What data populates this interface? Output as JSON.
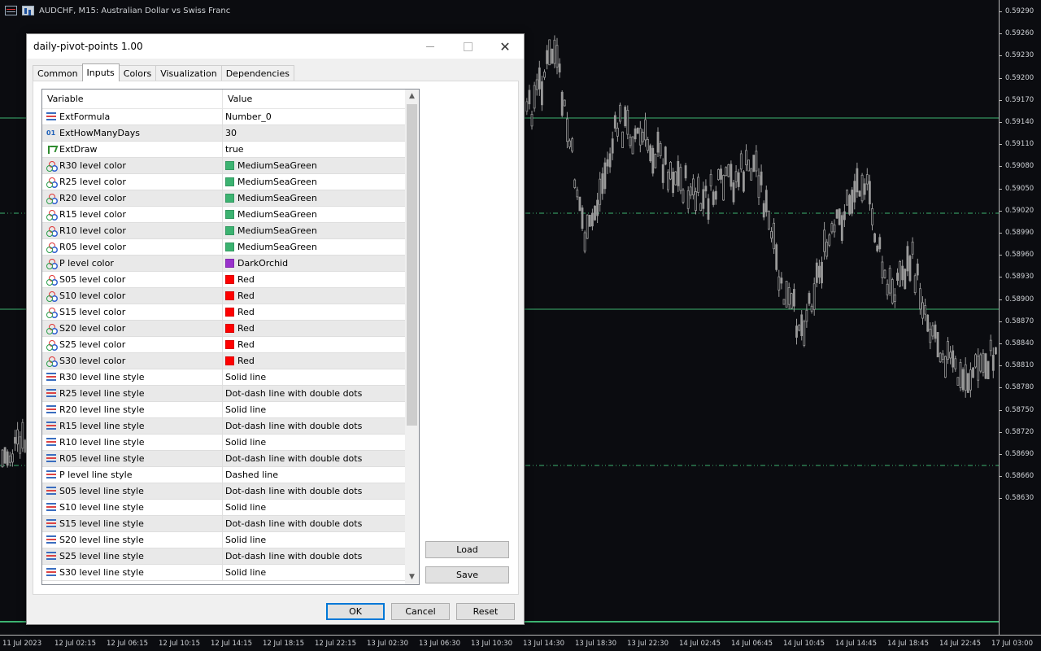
{
  "chart": {
    "symbol_title": "AUDCHF, M15:  Australian Dollar vs Swiss  Franc",
    "price_ticks": [
      "0.59290",
      "0.59260",
      "0.59230",
      "0.59200",
      "0.59170",
      "0.59140",
      "0.59110",
      "0.59080",
      "0.59050",
      "0.59020",
      "0.58990",
      "0.58960",
      "0.58930",
      "0.58900",
      "0.58870",
      "0.58840",
      "0.58810",
      "0.58780",
      "0.58750",
      "0.58720",
      "0.58690",
      "0.58660",
      "0.58630"
    ],
    "time_ticks": [
      "11 Jul 2023",
      "12 Jul 02:15",
      "12 Jul 06:15",
      "12 Jul 10:15",
      "12 Jul 14:15",
      "12 Jul 18:15",
      "12 Jul 22:15",
      "13 Jul 02:30",
      "13 Jul 06:30",
      "13 Jul 10:30",
      "13 Jul 14:30",
      "13 Jul 18:30",
      "13 Jul 22:30",
      "14 Jul 02:45",
      "14 Jul 06:45",
      "14 Jul 10:45",
      "14 Jul 14:45",
      "14 Jul 18:45",
      "14 Jul 22:45",
      "17 Jul 03:00"
    ],
    "colors": {
      "background": "#0b0c10",
      "candle": "#9a9a9a",
      "level": "#3cb371"
    }
  },
  "dialog": {
    "title": "daily-pivot-points 1.00",
    "close_label": "✕",
    "tabs": [
      {
        "label": "Common",
        "active": false
      },
      {
        "label": "Inputs",
        "active": true
      },
      {
        "label": "Colors",
        "active": false
      },
      {
        "label": "Visualization",
        "active": false
      },
      {
        "label": "Dependencies",
        "active": false
      }
    ],
    "grid": {
      "header_variable": "Variable",
      "header_value": "Value",
      "rows": [
        {
          "icon": "enum",
          "variable": "ExtFormula",
          "value": "Number_0"
        },
        {
          "icon": "int",
          "variable": "ExtHowManyDays",
          "value": "30"
        },
        {
          "icon": "bool",
          "variable": "ExtDraw",
          "value": "true"
        },
        {
          "icon": "color",
          "variable": "R30 level color",
          "value": "MediumSeaGreen",
          "swatch": "#3cb371"
        },
        {
          "icon": "color",
          "variable": "R25 level color",
          "value": "MediumSeaGreen",
          "swatch": "#3cb371"
        },
        {
          "icon": "color",
          "variable": "R20 level color",
          "value": "MediumSeaGreen",
          "swatch": "#3cb371"
        },
        {
          "icon": "color",
          "variable": "R15 level color",
          "value": "MediumSeaGreen",
          "swatch": "#3cb371"
        },
        {
          "icon": "color",
          "variable": "R10 level color",
          "value": "MediumSeaGreen",
          "swatch": "#3cb371"
        },
        {
          "icon": "color",
          "variable": "R05 level color",
          "value": "MediumSeaGreen",
          "swatch": "#3cb371"
        },
        {
          "icon": "color",
          "variable": "P level color",
          "value": "DarkOrchid",
          "swatch": "#9932cc"
        },
        {
          "icon": "color",
          "variable": "S05 level color",
          "value": "Red",
          "swatch": "#ff0000"
        },
        {
          "icon": "color",
          "variable": "S10 level color",
          "value": "Red",
          "swatch": "#ff0000"
        },
        {
          "icon": "color",
          "variable": "S15 level color",
          "value": "Red",
          "swatch": "#ff0000"
        },
        {
          "icon": "color",
          "variable": "S20 level color",
          "value": "Red",
          "swatch": "#ff0000"
        },
        {
          "icon": "color",
          "variable": "S25 level color",
          "value": "Red",
          "swatch": "#ff0000"
        },
        {
          "icon": "color",
          "variable": "S30 level color",
          "value": "Red",
          "swatch": "#ff0000"
        },
        {
          "icon": "enum",
          "variable": "R30 level line style",
          "value": "Solid line"
        },
        {
          "icon": "enum",
          "variable": "R25 level line style",
          "value": "Dot-dash line with double dots"
        },
        {
          "icon": "enum",
          "variable": "R20 level line style",
          "value": "Solid line"
        },
        {
          "icon": "enum",
          "variable": "R15 level line style",
          "value": "Dot-dash line with double dots"
        },
        {
          "icon": "enum",
          "variable": "R10 level line style",
          "value": "Solid line"
        },
        {
          "icon": "enum",
          "variable": "R05 level line style",
          "value": "Dot-dash line with double dots"
        },
        {
          "icon": "enum",
          "variable": "P level line style",
          "value": "Dashed line"
        },
        {
          "icon": "enum",
          "variable": "S05 level line style",
          "value": "Dot-dash line with double dots"
        },
        {
          "icon": "enum",
          "variable": "S10 level line style",
          "value": "Solid line"
        },
        {
          "icon": "enum",
          "variable": "S15 level line style",
          "value": "Dot-dash line with double dots"
        },
        {
          "icon": "enum",
          "variable": "S20 level line style",
          "value": "Solid line"
        },
        {
          "icon": "enum",
          "variable": "S25 level line style",
          "value": "Dot-dash line with double dots"
        },
        {
          "icon": "enum",
          "variable": "S30 level line style",
          "value": "Solid line"
        }
      ]
    },
    "buttons": {
      "load": "Load",
      "save": "Save",
      "ok": "OK",
      "cancel": "Cancel",
      "reset": "Reset"
    }
  }
}
